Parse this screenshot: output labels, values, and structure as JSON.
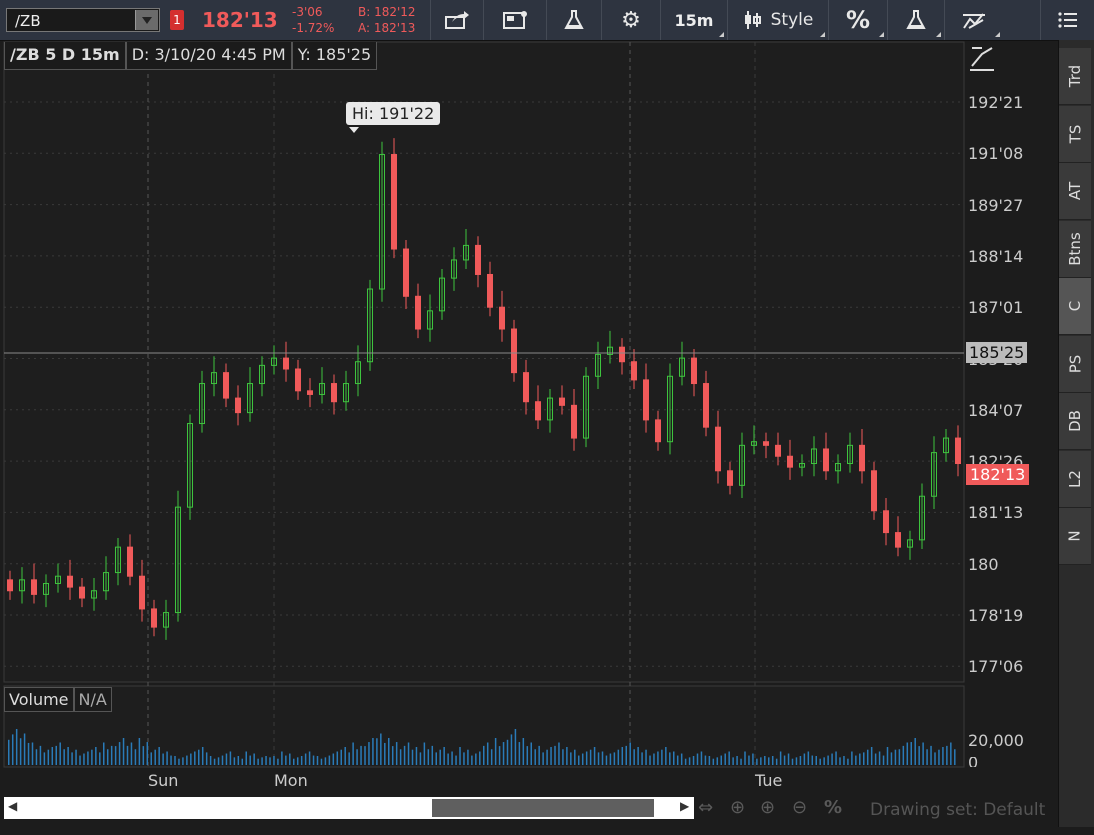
{
  "toolbar": {
    "symbol": "/ZB",
    "alert_count": "1",
    "last_price": "182'13",
    "change": "-3'06",
    "change_pct": "-1.72%",
    "bid": "B: 182'12",
    "ask": "A: 182'13",
    "interval": "15m",
    "style_label": "Style",
    "percent_label": "%"
  },
  "chart_header": {
    "title": "/ZB 5 D 15m",
    "date": "D: 3/10/20 4:45 PM",
    "yval": "Y: 185'25"
  },
  "annotations": {
    "high": "Hi: 191'22",
    "crosshair_price": "185'25",
    "last_price_tag": "182'13"
  },
  "price_axis": [
    "192'21",
    "191'08",
    "189'27",
    "188'14",
    "187'01",
    "185'20",
    "184'07",
    "182'26",
    "181'13",
    "180",
    "178'19",
    "177'06"
  ],
  "time_axis": [
    "Sun",
    "Mon",
    "Tue"
  ],
  "volume_panel": {
    "label": "Volume",
    "value": "N/A",
    "axis_labels": [
      "20,000",
      "0"
    ]
  },
  "right_tabs": [
    "Trd",
    "TS",
    "AT",
    "Btns",
    "C",
    "PS",
    "DB",
    "L2",
    "N"
  ],
  "bottom": {
    "drawing_set": "Drawing set: Default"
  },
  "colors": {
    "up": "#3ec43e",
    "down": "#f05a5a",
    "volume": "#2a7bb8",
    "background": "#1e1e1e"
  },
  "chart_data": {
    "type": "candlestick",
    "title": "/ZB 5 D 15m",
    "y_range": [
      "177'06",
      "192'21"
    ],
    "session_labels": [
      "Sun",
      "Mon",
      "Tue"
    ],
    "close_series": [
      178.9,
      179.2,
      178.8,
      179.1,
      179.3,
      179.0,
      178.7,
      178.9,
      179.4,
      180.1,
      179.3,
      178.4,
      177.9,
      178.3,
      181.2,
      183.5,
      184.6,
      184.9,
      184.2,
      183.8,
      184.6,
      185.1,
      185.3,
      185.0,
      184.4,
      184.3,
      184.6,
      184.1,
      184.6,
      185.2,
      187.2,
      190.9,
      188.3,
      187.0,
      186.1,
      186.6,
      187.5,
      188.0,
      188.4,
      187.6,
      186.7,
      186.1,
      184.9,
      184.1,
      183.6,
      184.2,
      184.0,
      183.1,
      184.8,
      185.4,
      185.6,
      185.2,
      184.7,
      183.6,
      183.0,
      184.8,
      185.3,
      184.6,
      183.4,
      182.2,
      181.8,
      182.9,
      183.0,
      182.9,
      182.6,
      182.3,
      182.4,
      182.8,
      182.2,
      182.4,
      182.9,
      182.2,
      181.1,
      180.5,
      180.1,
      180.3,
      181.5,
      182.7,
      183.1,
      182.4
    ],
    "volume_series": [
      0.8,
      0.7,
      0.5,
      0.4,
      0.5,
      0.4,
      0.3,
      0.4,
      0.5,
      0.6,
      0.5,
      0.6,
      0.4,
      0.3,
      0.2,
      0.3,
      0.4,
      0.2,
      0.3,
      0.2,
      0.3,
      0.2,
      0.2,
      0.3,
      0.2,
      0.3,
      0.2,
      0.3,
      0.4,
      0.5,
      0.6,
      0.7,
      0.6,
      0.5,
      0.4,
      0.5,
      0.4,
      0.3,
      0.4,
      0.3,
      0.5,
      0.6,
      0.8,
      0.6,
      0.5,
      0.4,
      0.5,
      0.4,
      0.3,
      0.4,
      0.3,
      0.4,
      0.5,
      0.4,
      0.3,
      0.4,
      0.3,
      0.2,
      0.3,
      0.2,
      0.3,
      0.2,
      0.3,
      0.2,
      0.2,
      0.3,
      0.2,
      0.3,
      0.2,
      0.3,
      0.2,
      0.3,
      0.4,
      0.3,
      0.4,
      0.5,
      0.6,
      0.5,
      0.4,
      0.5
    ]
  }
}
